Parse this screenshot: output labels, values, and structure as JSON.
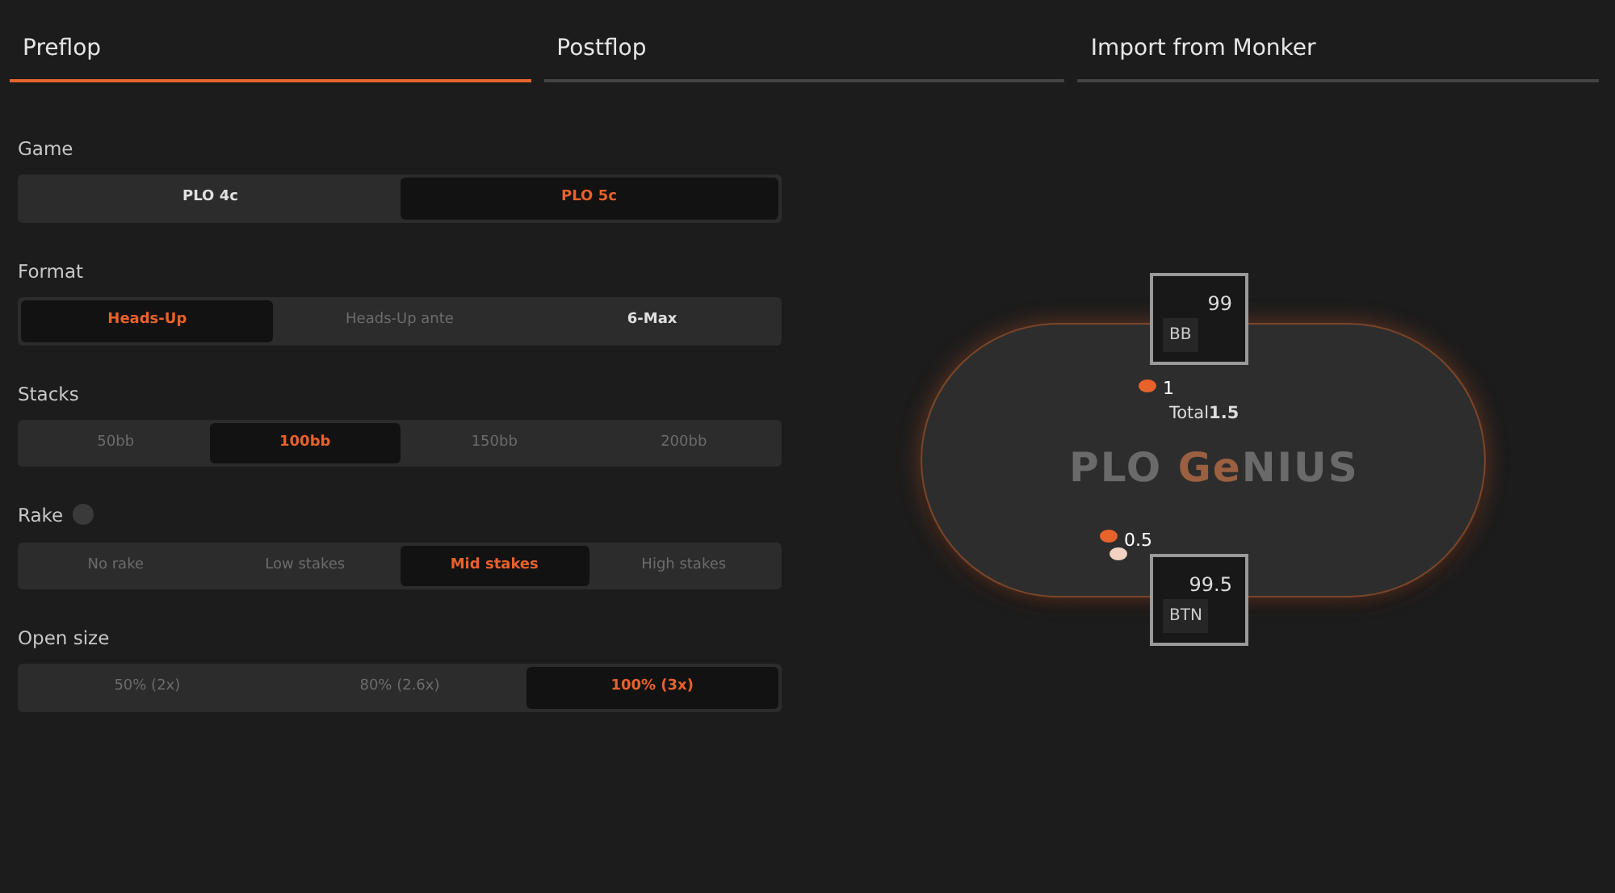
{
  "tabs": [
    {
      "label": "Preflop",
      "selected": true
    },
    {
      "label": "Postflop",
      "selected": false
    },
    {
      "label": "Import from Monker",
      "selected": false
    }
  ],
  "groups": [
    {
      "label": "Game",
      "info": false,
      "options": [
        {
          "label": "PLO 4c",
          "selected": false,
          "disabled": false
        },
        {
          "label": "PLO 5c",
          "selected": true,
          "disabled": false
        }
      ]
    },
    {
      "label": "Format",
      "info": false,
      "options": [
        {
          "label": "Heads-Up",
          "selected": true,
          "disabled": false
        },
        {
          "label": "Heads-Up ante",
          "selected": false,
          "disabled": true
        },
        {
          "label": "6-Max",
          "selected": false,
          "disabled": false
        }
      ]
    },
    {
      "label": "Stacks",
      "info": false,
      "options": [
        {
          "label": "50bb",
          "selected": false,
          "disabled": true
        },
        {
          "label": "100bb",
          "selected": true,
          "disabled": false
        },
        {
          "label": "150bb",
          "selected": false,
          "disabled": true
        },
        {
          "label": "200bb",
          "selected": false,
          "disabled": true
        }
      ]
    },
    {
      "label": "Rake",
      "info": true,
      "options": [
        {
          "label": "No rake",
          "selected": false,
          "disabled": true
        },
        {
          "label": "Low stakes",
          "selected": false,
          "disabled": true
        },
        {
          "label": "Mid stakes",
          "selected": true,
          "disabled": false
        },
        {
          "label": "High stakes",
          "selected": false,
          "disabled": true
        }
      ]
    },
    {
      "label": "Open size",
      "info": false,
      "options": [
        {
          "label": "50% (2x)",
          "selected": false,
          "disabled": true
        },
        {
          "label": "80% (2.6x)",
          "selected": false,
          "disabled": true
        },
        {
          "label": "100% (3x)",
          "selected": true,
          "disabled": false
        }
      ]
    }
  ],
  "table": {
    "logo": {
      "prefix": "PLO",
      "accent": "Ge",
      "suffix": "NIUS"
    },
    "seats": [
      {
        "position": "BB",
        "stack": "99",
        "kind": "top",
        "bet": "1"
      },
      {
        "position": "BTN",
        "stack": "99.5",
        "kind": "bottom",
        "bet": "0.5"
      }
    ],
    "pot": {
      "label": "Total",
      "amount": "1.5"
    }
  }
}
